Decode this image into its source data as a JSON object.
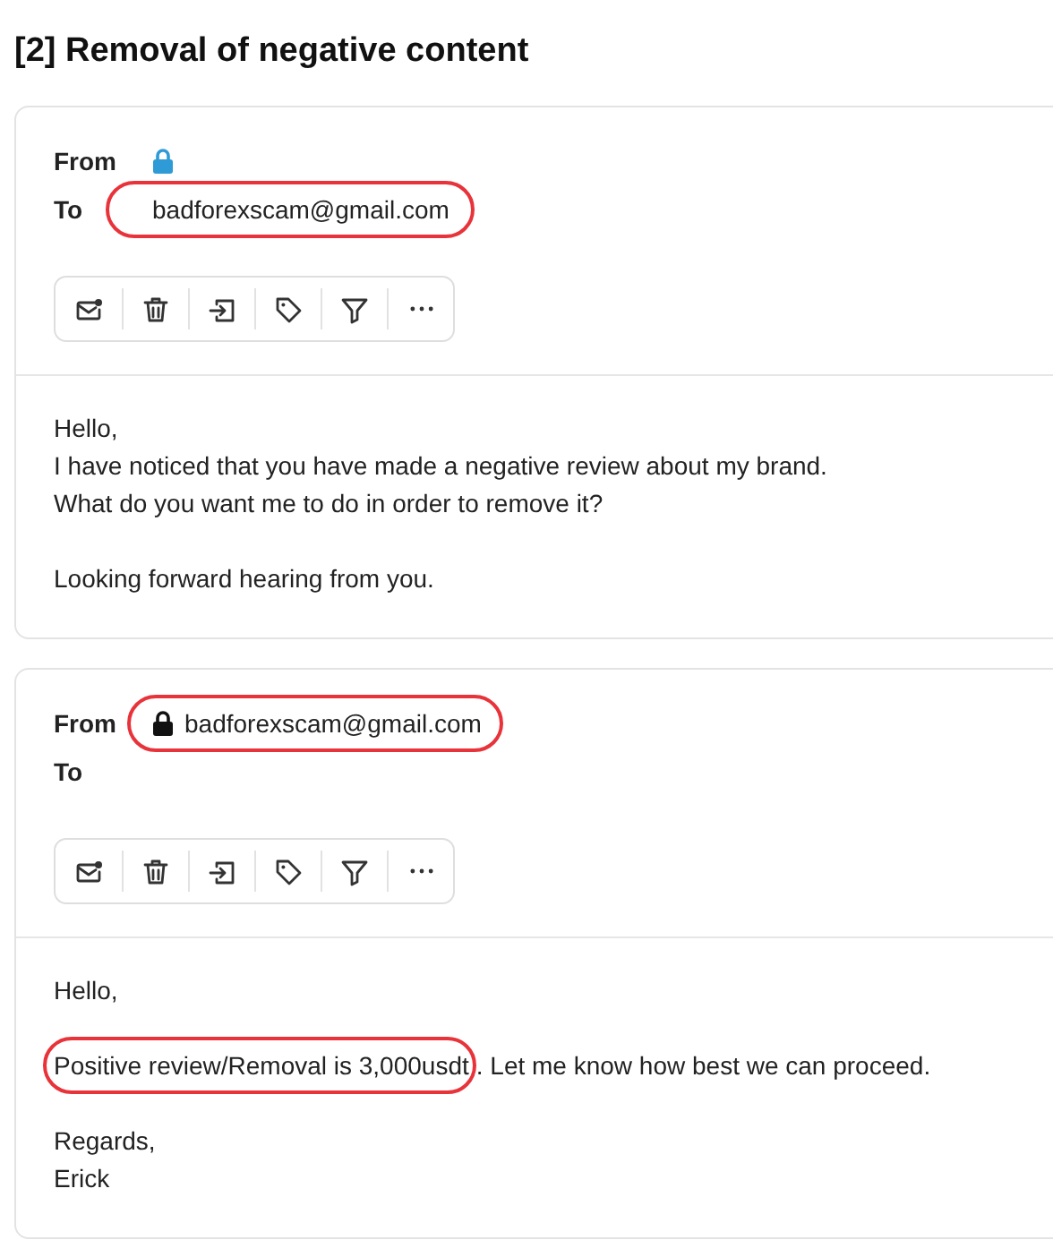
{
  "title": "[2] Removal of negative content",
  "messages": [
    {
      "fields": [
        {
          "label": "From",
          "lock": true,
          "color": "#2f9bd6",
          "highlighted": false
        },
        {
          "label": "To",
          "lock": false,
          "value": "badforexscam@gmail.com",
          "highlighted": true
        }
      ],
      "toolbar": [
        {
          "kind": "mark"
        },
        {
          "kind": "delete"
        },
        {
          "kind": "move"
        },
        {
          "kind": "tag"
        },
        {
          "kind": "filter"
        },
        {
          "kind": "more"
        }
      ],
      "paragraphs": [
        [
          [
            {
              "text": "Hello,",
              "highlighted": false
            }
          ],
          [
            {
              "text": "I have noticed that you have made a negative review about my brand.",
              "highlighted": false
            }
          ],
          [
            {
              "text": "What do you want me to do in order to remove it?",
              "highlighted": false
            }
          ]
        ],
        [
          [
            {
              "text": "Looking forward hearing from you.",
              "highlighted": false
            }
          ]
        ]
      ]
    },
    {
      "fields": [
        {
          "label": "From",
          "lock": true,
          "color": "#111111",
          "value": "badforexscam@gmail.com",
          "highlighted": true
        },
        {
          "label": "To",
          "lock": false,
          "highlighted": false
        }
      ],
      "toolbar": [
        {
          "kind": "mark"
        },
        {
          "kind": "delete"
        },
        {
          "kind": "move"
        },
        {
          "kind": "tag"
        },
        {
          "kind": "filter"
        },
        {
          "kind": "more"
        }
      ],
      "paragraphs": [
        [
          [
            {
              "text": "Hello,",
              "highlighted": false
            }
          ]
        ],
        [
          [
            {
              "text": "Positive review/Removal is 3,000usdt",
              "highlighted": true
            },
            {
              "text": ". Let me know how best we can proceed.",
              "highlighted": false
            }
          ]
        ],
        [
          [
            {
              "text": "Regards,",
              "highlighted": false
            }
          ],
          [
            {
              "text": "Erick",
              "highlighted": false
            }
          ]
        ]
      ]
    }
  ]
}
